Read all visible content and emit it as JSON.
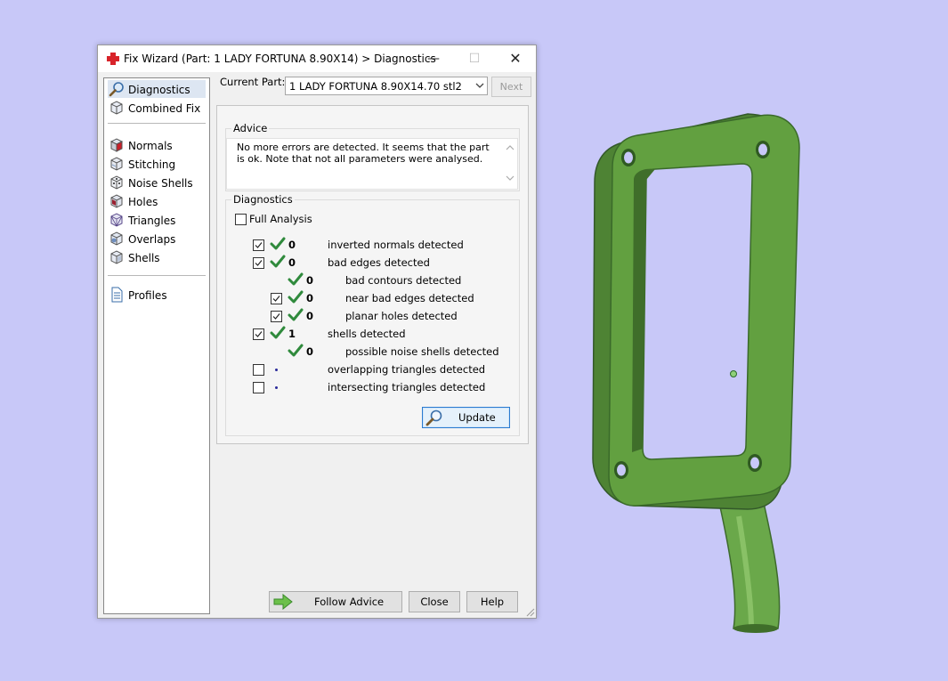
{
  "window": {
    "title": "Fix Wizard (Part: 1 LADY FORTUNA  8.90X14) > Diagnostics",
    "minimize_glyph": "—",
    "maximize_glyph": "☐",
    "close_glyph": "✕"
  },
  "sidebar": {
    "items": [
      {
        "label": "Diagnostics",
        "icon": "magnifier-icon",
        "selected": true
      },
      {
        "label": "Combined Fix",
        "icon": "cube-icon"
      },
      {
        "label": "Normals",
        "icon": "cube-red-face-icon"
      },
      {
        "label": "Stitching",
        "icon": "cube-icon"
      },
      {
        "label": "Noise Shells",
        "icon": "dice-icon"
      },
      {
        "label": "Holes",
        "icon": "cube-hole-icon"
      },
      {
        "label": "Triangles",
        "icon": "triangles-cube-icon"
      },
      {
        "label": "Overlaps",
        "icon": "overlap-cube-icon"
      },
      {
        "label": "Shells",
        "icon": "shells-cube-icon"
      },
      {
        "label": "Profiles",
        "icon": "document-icon"
      }
    ]
  },
  "current_part": {
    "label": "Current Part:",
    "value": "1 LADY FORTUNA  8.90X14.70 stl2",
    "next_label": "Next"
  },
  "advice": {
    "title": "Advice",
    "text": "No more errors are detected. It seems that the part is ok. Note that not all parameters were analysed."
  },
  "diagnostics": {
    "title": "Diagnostics",
    "full_analysis_label": "Full Analysis",
    "full_analysis_checked": false,
    "rows": [
      {
        "checked": true,
        "status": "ok",
        "count": "0",
        "label": "inverted normals detected",
        "indent": 0
      },
      {
        "checked": true,
        "status": "ok",
        "count": "0",
        "label": "bad edges detected",
        "indent": 0
      },
      {
        "checked": null,
        "status": "ok",
        "count": "0",
        "label": "bad contours detected",
        "indent": 1
      },
      {
        "checked": true,
        "status": "ok",
        "count": "0",
        "label": "near bad edges detected",
        "indent": 1
      },
      {
        "checked": true,
        "status": "ok",
        "count": "0",
        "label": "planar holes detected",
        "indent": 1
      },
      {
        "checked": true,
        "status": "ok",
        "count": "1",
        "label": "shells detected",
        "indent": 0
      },
      {
        "checked": null,
        "status": "ok",
        "count": "0",
        "label": "possible noise shells detected",
        "indent": 1
      },
      {
        "checked": false,
        "status": "pending",
        "count": "",
        "label": "overlapping triangles detected",
        "indent": 0
      },
      {
        "checked": false,
        "status": "pending",
        "count": "",
        "label": "intersecting triangles detected",
        "indent": 0
      }
    ],
    "update_label": "Update"
  },
  "buttons": {
    "follow_advice": "Follow Advice",
    "close": "Close",
    "help": "Help"
  },
  "colors": {
    "background": "#c8c8f8",
    "model_green": "#5e9a3c",
    "check_green": "#2f8a3c",
    "selection": "#dde6f2"
  }
}
